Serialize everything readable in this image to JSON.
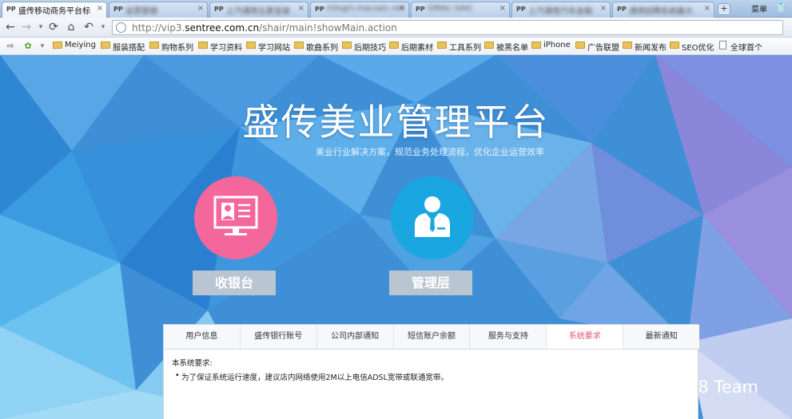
{
  "browser": {
    "tabs": [
      {
        "label": "盛传移动商务平台标",
        "active": true
      },
      {
        "label": "运营管理",
        "active": false
      },
      {
        "label": "上汽通用五菱宝骏",
        "active": false
      },
      {
        "label": "mlogin.macsaic.net",
        "active": false
      },
      {
        "label": "GMAC-SAIC",
        "active": false
      },
      {
        "label": "上汽通用汽车金融",
        "active": false
      },
      {
        "label": "通用招聘系统最大",
        "active": false
      }
    ],
    "new_tab": "+",
    "right_label": "菜单",
    "url_prefix": "http://vip3.",
    "url_domain": "sentree.com.cn",
    "url_path": "/shair/main!showMain.action",
    "bookmarks": [
      "Meiying",
      "服装搭配",
      "购物系列",
      "学习资料",
      "学习网站",
      "歌曲系列",
      "后期技巧",
      "后期素材",
      "工具系列",
      "被黑名单",
      "iPhone",
      "广告联盟",
      "新闻发布",
      "SEO优化",
      "全球首个"
    ]
  },
  "page": {
    "title": "盛传美业管理平台",
    "subtitle": "美业行业解决方案，规范业务处理流程，优化企业运营效率",
    "modules": [
      {
        "label": "收银台",
        "icon": "monitor-icon",
        "color": "#f4679a"
      },
      {
        "label": "管理层",
        "icon": "manager-icon",
        "color": "#1aa6e0"
      }
    ],
    "panel_tabs": [
      "用户信息",
      "盛传银行账号",
      "公司内部通知",
      "短信账户余额",
      "服务与支持",
      "系统要求",
      "最新通知"
    ],
    "active_panel_tab": 5,
    "requirement_title": "本系统要求:",
    "requirement_item": "为了保证系统运行速度，建议店内网络使用2M以上电信ADSL宽带或联通宽带。",
    "watermark": "f8 Team"
  }
}
